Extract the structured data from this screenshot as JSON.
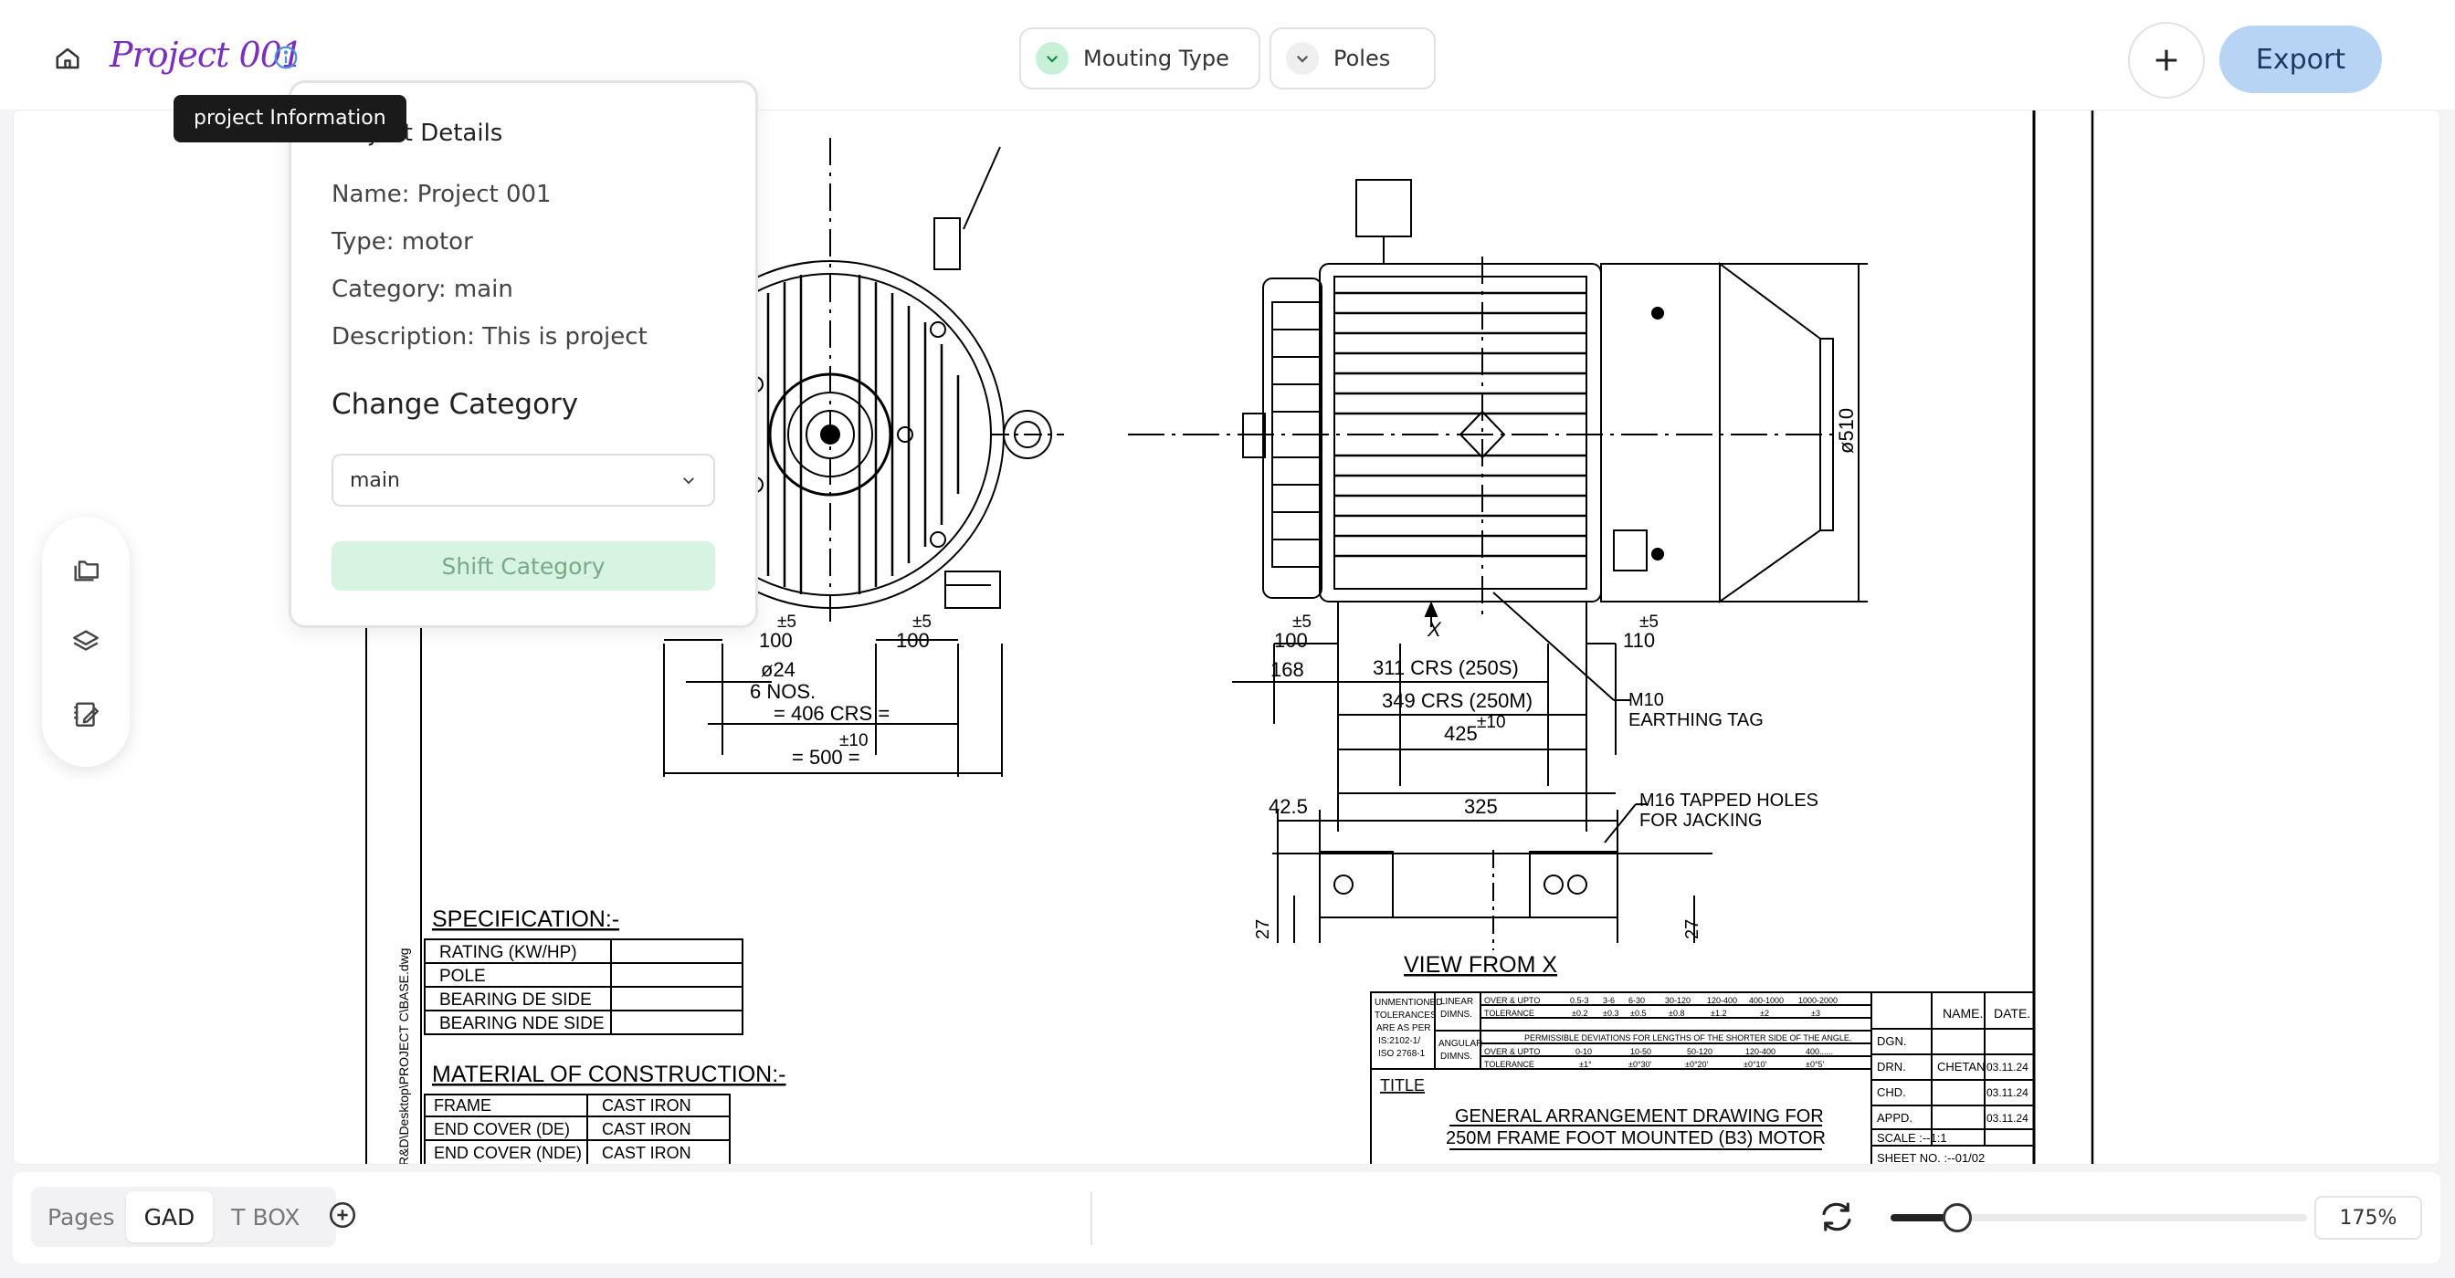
{
  "header": {
    "project_title": "Project 001",
    "tooltip": "project Information",
    "filters": [
      {
        "label": "Mouting Type",
        "icon": "chevron-down-icon",
        "active": true
      },
      {
        "label": "Poles",
        "icon": "chevron-down-icon",
        "active": false
      }
    ],
    "export_label": "Export"
  },
  "popover": {
    "heading": "Project Details",
    "name": "Name: Project 001",
    "type": "Type: motor",
    "category": "Category: main",
    "description": "Description: This is project",
    "change_heading": "Change Category",
    "select_value": "main",
    "shift_label": "Shift Category"
  },
  "drawing": {
    "dims_left": [
      "±5",
      "100",
      "±5",
      "100",
      "ø24",
      "6 NOS.",
      "= 406 CRS =",
      "±10",
      "= 500 ="
    ],
    "dims_right": [
      "±5",
      "100",
      "±5",
      "110",
      "168",
      "311 CRS (250S)",
      "349 CRS (250M)",
      "425",
      "±10",
      "M10",
      "EARTHING TAG",
      "ø510",
      "X"
    ],
    "view_x": {
      "dim1": "42.5",
      "dim2": "325",
      "note1": "M16 TAPPED HOLES",
      "note2": "FOR JACKING",
      "height_left": "27",
      "height_right": "27",
      "title": "VIEW FROM X"
    },
    "spec": {
      "title": "SPECIFICATION:-",
      "rows": [
        "RATING (KW/HP)",
        "POLE",
        "BEARING DE SIDE",
        "BEARING NDE SIDE"
      ]
    },
    "material": {
      "title": "MATERIAL OF CONSTRUCTION:-",
      "rows": [
        [
          "FRAME",
          "CAST IRON"
        ],
        [
          "END COVER (DE)",
          "CAST IRON"
        ],
        [
          "END COVER (NDE)",
          "CAST IRON"
        ]
      ]
    },
    "side_path": "R&D\\Desktop\\PROJECT C\\BASE.dwg",
    "title_block": {
      "tol_label": [
        "UNMENTIONED",
        "TOLERANCES",
        "ARE AS PER",
        "IS:2102-1/",
        "ISO 2768-1"
      ],
      "linear": [
        "LINEAR",
        "DIMNS."
      ],
      "angular": [
        "ANGULAR",
        "DIMNS."
      ],
      "over_upto": "OVER & UPTO",
      "tolerance": "TOLERANCE",
      "linear_ranges": [
        "0.5-3",
        "3-6",
        "6-30",
        "30-120",
        "120-400",
        "400-1000",
        "1000-2000"
      ],
      "linear_tols": [
        "±0.2",
        "±0.3",
        "±0.5",
        "±0.8",
        "±1.2",
        "±2",
        "±3"
      ],
      "perm_note": "PERMISSIBLE DEVIATIONS FOR LENGTHS OF THE SHORTER SIDE OF THE ANGLE.",
      "angular_ranges": [
        "0-10",
        "10-50",
        "50-120",
        "120-400",
        "400......"
      ],
      "angular_tols": [
        "±1°",
        "±0°30'",
        "±0°20'",
        "±0°10'",
        "±0°5'"
      ],
      "title_label": "TITLE",
      "title_line1": "GENERAL ARRANGEMENT DRAWING FOR",
      "title_line2": "250M FRAME FOOT MOUNTED (B3) MOTOR",
      "name_head": "NAME.",
      "date_head": "DATE.",
      "roles": [
        "DGN.",
        "DRN.",
        "CHD.",
        "APPD."
      ],
      "names": [
        "",
        "CHETAN",
        "",
        ""
      ],
      "dates": [
        "",
        "03.11.24",
        "03.11.24",
        "03.11.24"
      ],
      "scale": "SCALE :--1:1",
      "sheet": "SHEET NO. :--01/02"
    }
  },
  "bottom": {
    "pages_label": "Pages",
    "tabs": [
      "GAD",
      "T BOX"
    ],
    "active_tab": 0,
    "zoom_fraction": 0.16,
    "zoom_label": "175%"
  }
}
